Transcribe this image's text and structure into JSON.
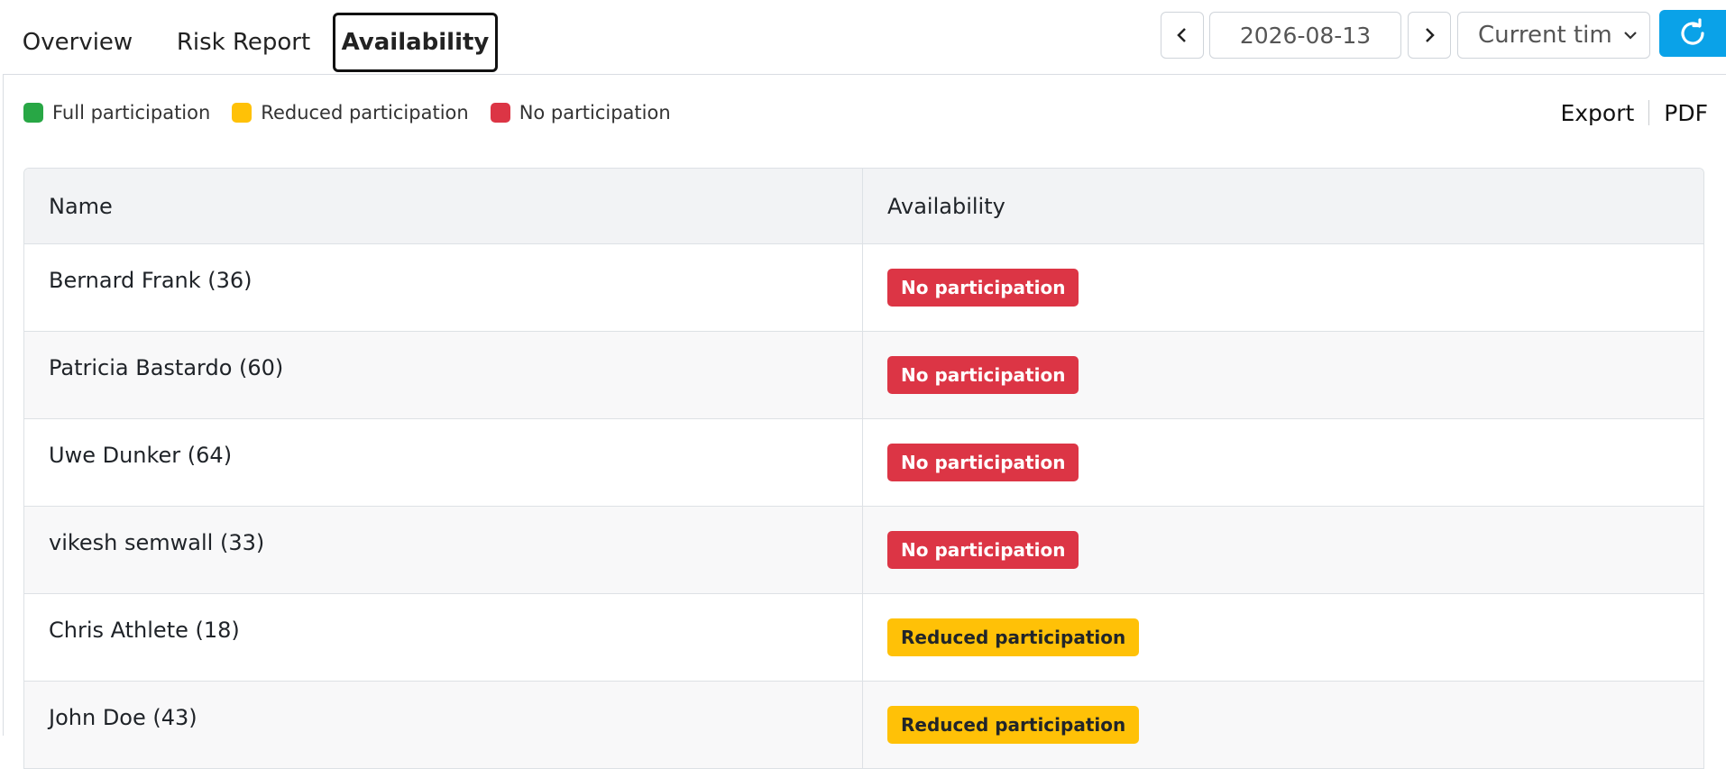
{
  "tabs": [
    {
      "label": "Overview",
      "active": false
    },
    {
      "label": "Risk Report",
      "active": false
    },
    {
      "label": "Availability",
      "active": true
    }
  ],
  "toolbar": {
    "date": "2026-08-13",
    "time_select": "Current tim",
    "refresh_color": "#0aa2e8"
  },
  "legend": [
    {
      "label": "Full participation",
      "color": "#28a745"
    },
    {
      "label": "Reduced participation",
      "color": "#ffc107"
    },
    {
      "label": "No participation",
      "color": "#dc3545"
    }
  ],
  "actions": {
    "export": "Export",
    "pdf": "PDF"
  },
  "table": {
    "columns": [
      "Name",
      "Availability"
    ],
    "rows": [
      {
        "name": "Bernard Frank (36)",
        "status": "No participation",
        "kind": "none"
      },
      {
        "name": "Patricia Bastardo (60)",
        "status": "No participation",
        "kind": "none"
      },
      {
        "name": "Uwe Dunker (64)",
        "status": "No participation",
        "kind": "none"
      },
      {
        "name": "vikesh semwall (33)",
        "status": "No participation",
        "kind": "none"
      },
      {
        "name": "Chris Athlete (18)",
        "status": "Reduced participation",
        "kind": "reduced"
      },
      {
        "name": "John Doe (43)",
        "status": "Reduced participation",
        "kind": "reduced"
      }
    ]
  }
}
